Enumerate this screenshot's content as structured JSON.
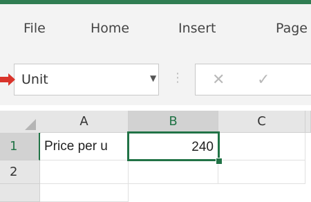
{
  "ribbon": {
    "tabs": [
      "File",
      "Home",
      "Insert",
      "Page"
    ]
  },
  "formula_bar": {
    "name_box_value": "Unit",
    "name_box_dropdown_icon": "chevron-down-icon",
    "cancel_icon": "close-icon",
    "enter_icon": "checkmark-icon",
    "separator": "⋮"
  },
  "grid": {
    "columns": [
      "A",
      "B",
      "C"
    ],
    "rows": [
      "1",
      "2"
    ],
    "cells": {
      "A1": "Price per u",
      "B1": "240",
      "C1": "",
      "A2": "",
      "B2": "",
      "C2": ""
    },
    "selected_cell": "B1"
  },
  "colors": {
    "accent": "#217346",
    "pointer": "#d9342b"
  }
}
